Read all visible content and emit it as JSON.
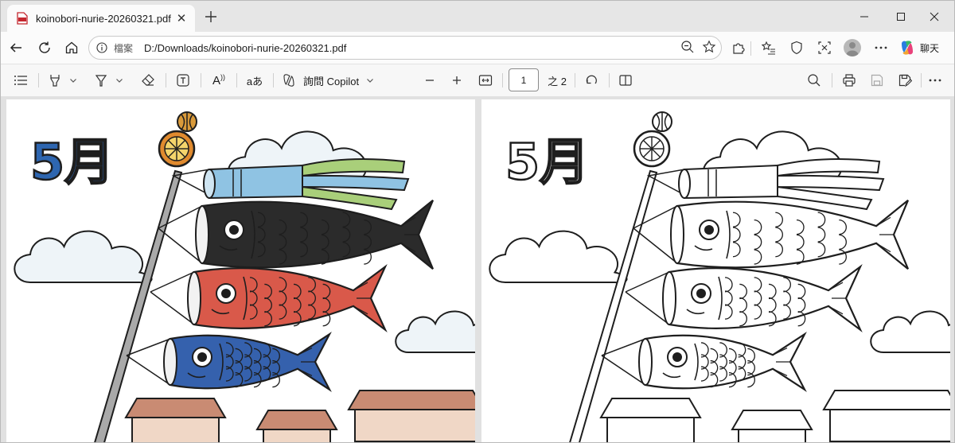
{
  "browser": {
    "tab": {
      "title": "koinobori-nurie-20260321.pdf"
    },
    "address": {
      "label": "檔案",
      "url": "D:/Downloads/koinobori-nurie-20260321.pdf"
    },
    "chat_label": "聊天"
  },
  "pdf_toolbar": {
    "copilot_label": "詢問 Copilot",
    "page_current": "1",
    "page_total": "之 2",
    "read_aloud_glyph": "A",
    "translate_glyph": "aあ"
  },
  "pages": [
    {
      "mode": "colored",
      "month_text": "5月"
    },
    {
      "mode": "outline",
      "month_text": "5月"
    }
  ],
  "colors": {
    "accent_blue": "#2e66b0",
    "carp_black": "#2b2b2b",
    "carp_red": "#d9594a",
    "carp_blue": "#3561ad",
    "streamer_green": "#a9cf7a",
    "streamer_blue": "#8fc3e3",
    "ball_orange": "#e08a2e",
    "roof_brown": "#c98b73"
  }
}
